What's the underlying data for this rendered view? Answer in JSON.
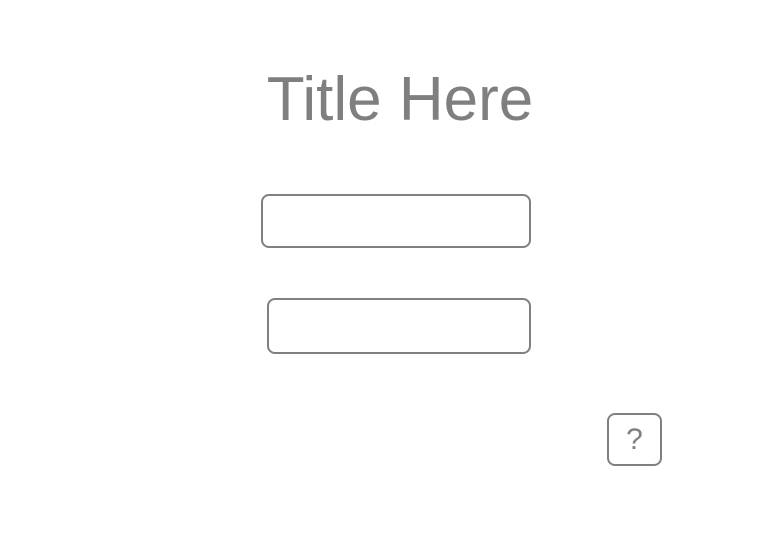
{
  "page": {
    "title": "Title Here"
  },
  "form": {
    "field_1": {
      "value": "",
      "placeholder": ""
    },
    "field_2": {
      "value": "",
      "placeholder": ""
    }
  },
  "help_button": {
    "label": "?",
    "icon": "question-mark-icon"
  },
  "colors": {
    "text": "#7f7f7f",
    "border": "#808080",
    "background": "#ffffff"
  }
}
